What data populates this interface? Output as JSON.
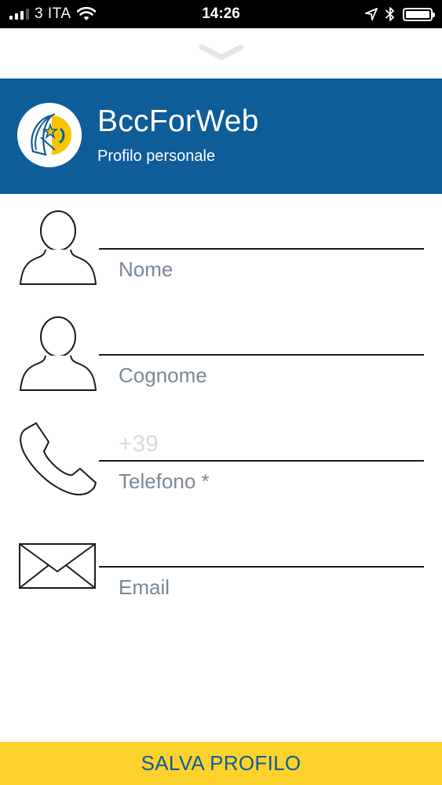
{
  "status_bar": {
    "carrier": "3 ITA",
    "time": "14:26",
    "icons": [
      "signal-icon",
      "wifi-icon",
      "location-icon",
      "bluetooth-icon",
      "battery-icon"
    ]
  },
  "header": {
    "title": "BccForWeb",
    "subtitle": "Profilo personale",
    "background_color": "#0e5c98"
  },
  "form": {
    "fields": [
      {
        "id": "nome",
        "icon": "person-icon",
        "value": "",
        "placeholder": "",
        "label": "Nome"
      },
      {
        "id": "cognome",
        "icon": "person-icon",
        "value": "",
        "placeholder": "",
        "label": "Cognome"
      },
      {
        "id": "telefono",
        "icon": "phone-icon",
        "value": "",
        "placeholder": "+39",
        "label": "Telefono *"
      },
      {
        "id": "email",
        "icon": "envelope-icon",
        "value": "",
        "placeholder": "",
        "label": "Email"
      }
    ]
  },
  "footer": {
    "save_label": "SALVA PROFILO",
    "button_color": "#fdd22d",
    "text_color": "#0e5c98"
  }
}
